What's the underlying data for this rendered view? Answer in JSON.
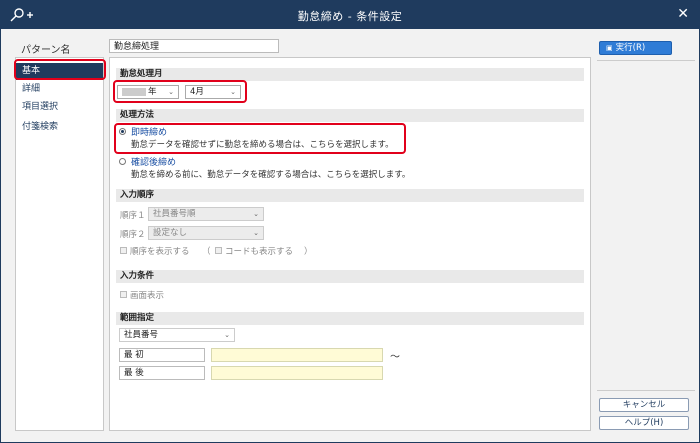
{
  "window": {
    "title": "勤怠締め - 条件設定",
    "close_label": "✕",
    "key_icon": "key-plus-icon"
  },
  "pattern": {
    "label": "パターン名",
    "value": "勤怠締処理"
  },
  "nav": {
    "items": [
      {
        "label": "基本"
      },
      {
        "label": "詳細"
      },
      {
        "label": "項目選択"
      },
      {
        "label": "付箋検索"
      }
    ]
  },
  "month_section": {
    "title": "勤怠処理月",
    "year_suffix": "年",
    "month_value": "4月"
  },
  "method_section": {
    "title": "処理方法",
    "options": [
      {
        "label": "即時締め",
        "desc": "勤怠データを確認せずに勤怠を締める場合は、こちらを選択します。"
      },
      {
        "label": "確認後締め",
        "desc": "勤怠を締める前に、勤怠データを確認する場合は、こちらを選択します。"
      }
    ]
  },
  "order_section": {
    "title": "入力順序",
    "order1_label": "順序１",
    "order1_value": "社員番号順",
    "order2_label": "順序２",
    "order2_value": "設定なし",
    "show_order_label": "順序を表示する",
    "paren_open": "（",
    "show_code_label": "コードも表示する",
    "paren_close": "）"
  },
  "input_cond_section": {
    "title": "入力条件",
    "screen_display_label": "画面表示"
  },
  "range_section": {
    "title": "範囲指定",
    "field_value": "社員番号",
    "first_label": "最 初",
    "last_label": "最 後",
    "tilde": "～"
  },
  "buttons": {
    "run": "実行(R)",
    "cancel": "キャンセル",
    "help": "ヘルプ(H)"
  },
  "colors": {
    "titlebar": "#1f3b5e",
    "highlight": "#e1001b",
    "primary": "#2f7cd6",
    "input_yellow": "#fffbd6"
  }
}
